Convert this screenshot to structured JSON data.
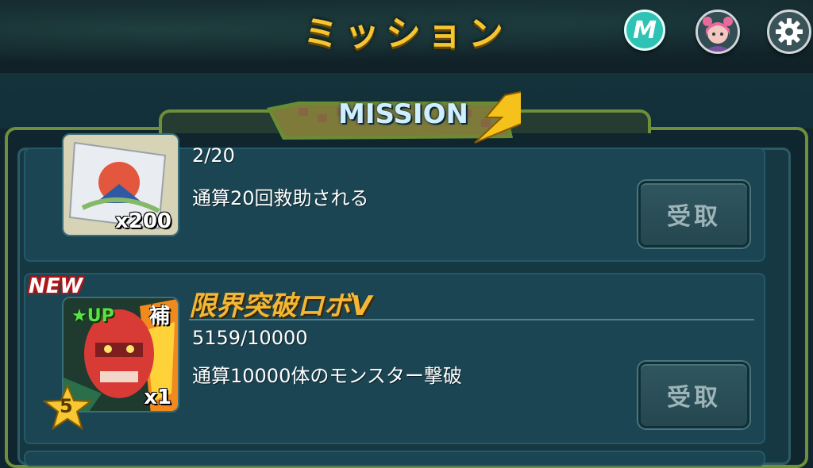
{
  "header": {
    "title": "ミッション",
    "monst_button": "M"
  },
  "section": {
    "label": "MISSION"
  },
  "missions": [
    {
      "progress": "2/20",
      "description": "通算20回救助される",
      "reward_qty": "x200",
      "claim_label": "受取"
    },
    {
      "name": "限界突破ロボV",
      "progress": "5159/10000",
      "description": "通算10000体のモンスター撃破",
      "reward_qty": "x1",
      "claim_label": "受取",
      "new_badge": "NEW",
      "up_badge": "★UP",
      "type_badge": "補",
      "rarity": "5"
    }
  ],
  "colors": {
    "title_gold": "#f6c630",
    "frame_green": "#6f8f3a",
    "panel_teal": "#1b4552",
    "monst_button": "#2fc3b6"
  }
}
